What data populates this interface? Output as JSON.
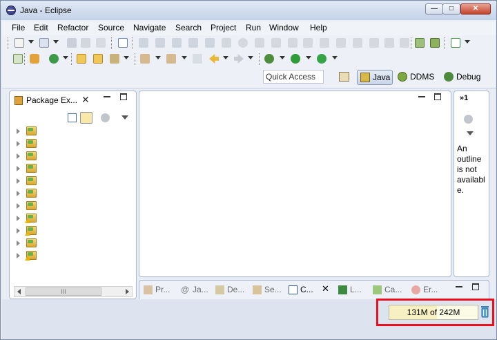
{
  "window": {
    "title": "Java - Eclipse",
    "minimize": "—",
    "maximize": "□",
    "close": "✕"
  },
  "menubar": [
    "File",
    "Edit",
    "Refactor",
    "Source",
    "Navigate",
    "Search",
    "Project",
    "Run",
    "Window",
    "Help"
  ],
  "perspective_bar": {
    "quick_access_placeholder": "Quick Access",
    "perspectives": [
      "Java",
      "DDMS",
      "Debug"
    ],
    "active": "Java"
  },
  "package_explorer": {
    "tab_label": "Package Ex...",
    "close": "✕",
    "scroll_thumb": "III",
    "project_count": 11,
    "warning_rows": [
      7,
      8,
      10
    ]
  },
  "outline": {
    "overflow_label": "»1",
    "message": "An outline is not available."
  },
  "bottom_tabs": [
    "Pr...",
    "Ja...",
    "De...",
    "Se...",
    "C...",
    "L...",
    "Ca...",
    "Er..."
  ],
  "bottom_active_tab": "C...",
  "bottom_close": "✕",
  "status": {
    "heap_used": "131M",
    "heap_total": "242M",
    "heap_label": "131M of 242M",
    "heap_fraction": 0.54
  },
  "colors": {
    "highlight": "#e8101c",
    "frame": "#e8edf5",
    "close_button": "#c4442c"
  }
}
